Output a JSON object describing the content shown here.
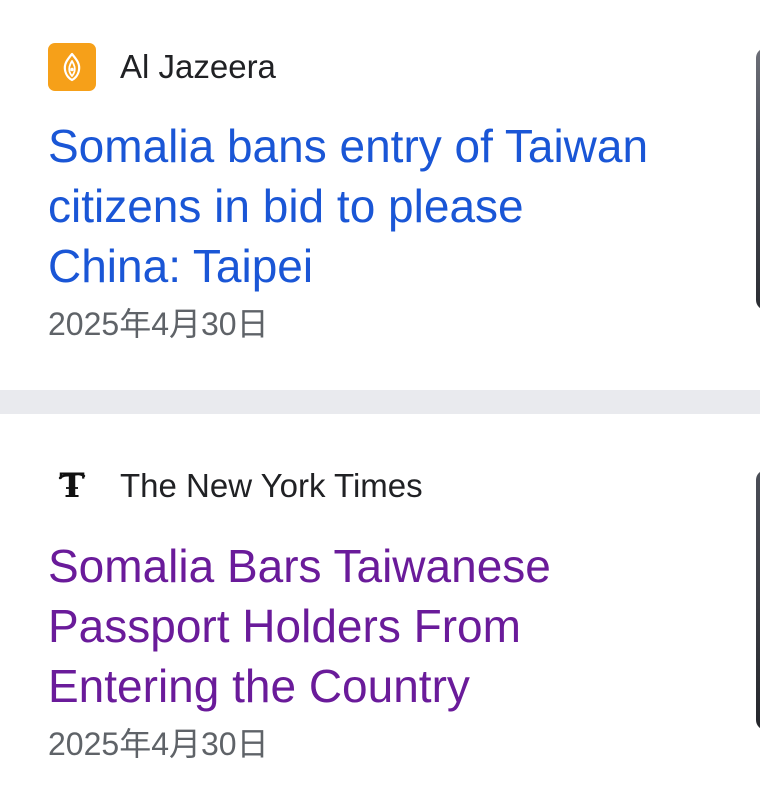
{
  "colors": {
    "headline_unvisited": "#1a56d6",
    "headline_visited": "#6a1b9a",
    "source_text": "#202124",
    "date_text": "#5f6368",
    "divider": "#e9eaee",
    "aljazeera_brand": "#f6a019"
  },
  "articles": [
    {
      "source": "Al Jazeera",
      "logo_icon": "al-jazeera-logo-icon",
      "headline": "Somalia bans entry of Taiwan citizens in bid to please China: Taipei",
      "date": "2025年4月30日",
      "visited": false
    },
    {
      "source": "The New York Times",
      "logo_icon": "nyt-logo-icon",
      "headline": "Somalia Bars Taiwanese Passport Holders From Entering the Country",
      "date": "2025年4月30日",
      "visited": true
    }
  ]
}
